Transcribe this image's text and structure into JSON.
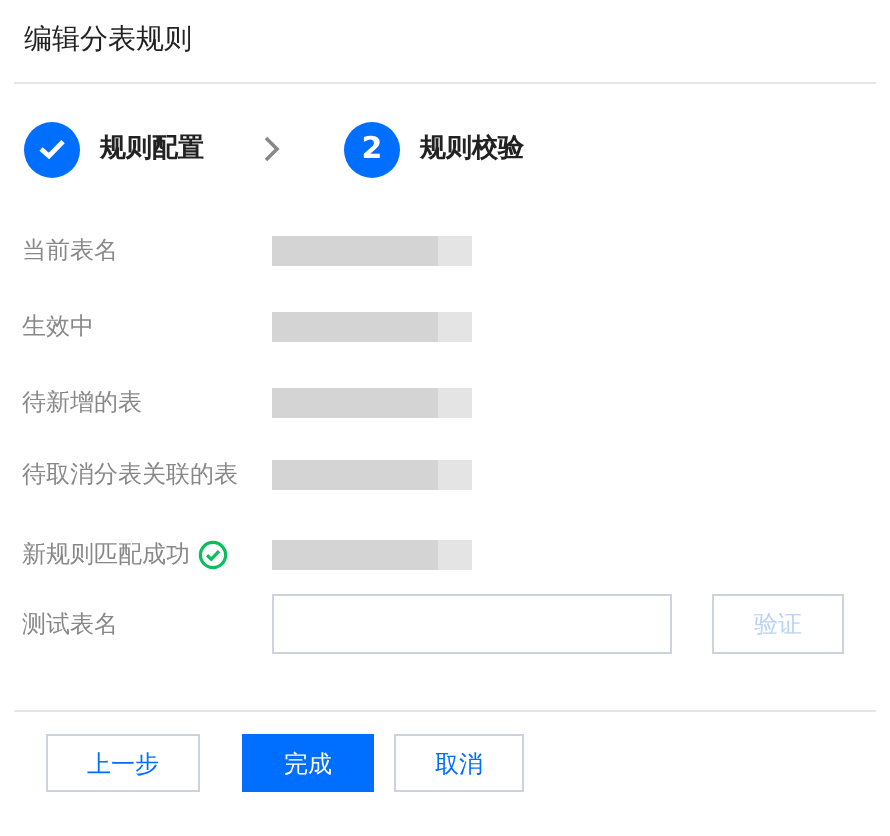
{
  "dialog": {
    "title": "编辑分表规则"
  },
  "steps": [
    {
      "label": "规则配置",
      "completed": true
    },
    {
      "label": "规则校验",
      "completed": false,
      "number": "2"
    }
  ],
  "rows": [
    {
      "label": "当前表名",
      "redacted": true
    },
    {
      "label": "生效中",
      "redacted": true
    },
    {
      "label": "待新增的表",
      "redacted": true
    },
    {
      "label": "待取消分表关联的表",
      "redacted": true
    },
    {
      "label": "新规则匹配成功",
      "redacted": true,
      "success": true
    }
  ],
  "test": {
    "label": "测试表名",
    "verify_button": {
      "label": "验证",
      "disabled": true
    }
  },
  "footer_buttons": [
    {
      "label": "上一步",
      "kind": "outline"
    },
    {
      "label": "完成",
      "kind": "primary"
    },
    {
      "label": "取消",
      "kind": "outline"
    }
  ]
}
